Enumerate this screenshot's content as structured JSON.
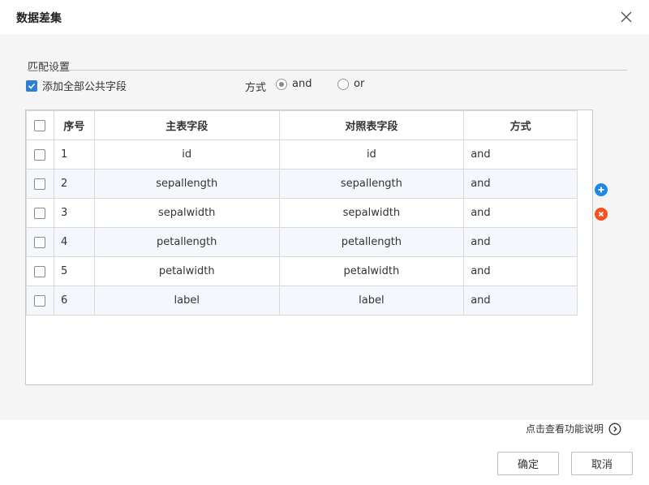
{
  "dialog": {
    "title": "数据差集"
  },
  "match": {
    "section_title": "匹配设置",
    "add_all_label": "添加全部公共字段",
    "add_all_checked": true,
    "mode_label": "方式",
    "options": [
      {
        "label": "and",
        "selected": true
      },
      {
        "label": "or",
        "selected": false
      }
    ]
  },
  "table": {
    "headers": [
      "序号",
      "主表字段",
      "对照表字段",
      "方式"
    ],
    "rows": [
      {
        "no": "1",
        "main": "id",
        "ref": "id",
        "mode": "and"
      },
      {
        "no": "2",
        "main": "sepallength",
        "ref": "sepallength",
        "mode": "and"
      },
      {
        "no": "3",
        "main": "sepalwidth",
        "ref": "sepalwidth",
        "mode": "and"
      },
      {
        "no": "4",
        "main": "petallength",
        "ref": "petallength",
        "mode": "and"
      },
      {
        "no": "5",
        "main": "petalwidth",
        "ref": "petalwidth",
        "mode": "and"
      },
      {
        "no": "6",
        "main": "label",
        "ref": "label",
        "mode": "and"
      }
    ]
  },
  "footer": {
    "help_label": "点击查看功能说明",
    "ok_label": "确定",
    "cancel_label": "取消"
  },
  "icons": {
    "close": "close-icon",
    "add": "plus-circle-icon",
    "remove": "remove-circle-icon",
    "help": "chevron-right-circle-icon"
  },
  "colors": {
    "accent": "#2f7fd3",
    "add": "#1e88e5",
    "remove": "#f4511e",
    "panel": "#f5f5f5",
    "row_alt": "#f4f7fb"
  }
}
